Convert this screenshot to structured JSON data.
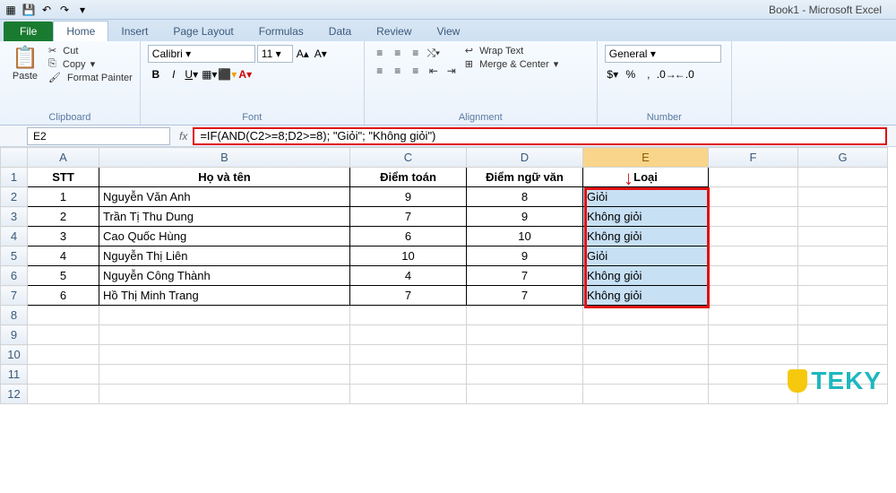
{
  "app": {
    "title": "Book1 - Microsoft Excel"
  },
  "qat": {
    "save": "💾",
    "undo": "↶",
    "redo": "↷"
  },
  "tabs": {
    "file": "File",
    "home": "Home",
    "insert": "Insert",
    "pagelayout": "Page Layout",
    "formulas": "Formulas",
    "data": "Data",
    "review": "Review",
    "view": "View"
  },
  "ribbon": {
    "clipboard": {
      "paste": "Paste",
      "cut": "Cut",
      "copy": "Copy",
      "fmtpainter": "Format Painter",
      "label": "Clipboard"
    },
    "font": {
      "name": "Calibri",
      "size": "11",
      "label": "Font"
    },
    "alignment": {
      "wrap": "Wrap Text",
      "merge": "Merge & Center",
      "label": "Alignment"
    },
    "number": {
      "format": "General",
      "label": "Number"
    }
  },
  "namebox": "E2",
  "formula": "=IF(AND(C2>=8;D2>=8); \"Giỏi\"; \"Không giỏi\")",
  "cols": [
    "A",
    "B",
    "C",
    "D",
    "E",
    "F",
    "G"
  ],
  "headers": {
    "A": "STT",
    "B": "Họ và tên",
    "C": "Điểm toán",
    "D": "Điểm ngữ văn",
    "E": "Loại"
  },
  "rows": [
    {
      "n": "2",
      "A": "1",
      "B": "Nguyễn Văn Anh",
      "C": "9",
      "D": "8",
      "E": "Giỏi"
    },
    {
      "n": "3",
      "A": "2",
      "B": "Trần Tị Thu Dung",
      "C": "7",
      "D": "9",
      "E": "Không giỏi"
    },
    {
      "n": "4",
      "A": "3",
      "B": "Cao Quốc Hùng",
      "C": "6",
      "D": "10",
      "E": "Không giỏi"
    },
    {
      "n": "5",
      "A": "4",
      "B": "Nguyễn Thị Liên",
      "C": "10",
      "D": "9",
      "E": "Giỏi"
    },
    {
      "n": "6",
      "A": "5",
      "B": "Nguyễn Công Thành",
      "C": "4",
      "D": "7",
      "E": "Không giỏi"
    },
    {
      "n": "7",
      "A": "6",
      "B": "Hồ Thị Minh Trang",
      "C": "7",
      "D": "7",
      "E": "Không giỏi"
    }
  ],
  "watermark": "TEKY"
}
